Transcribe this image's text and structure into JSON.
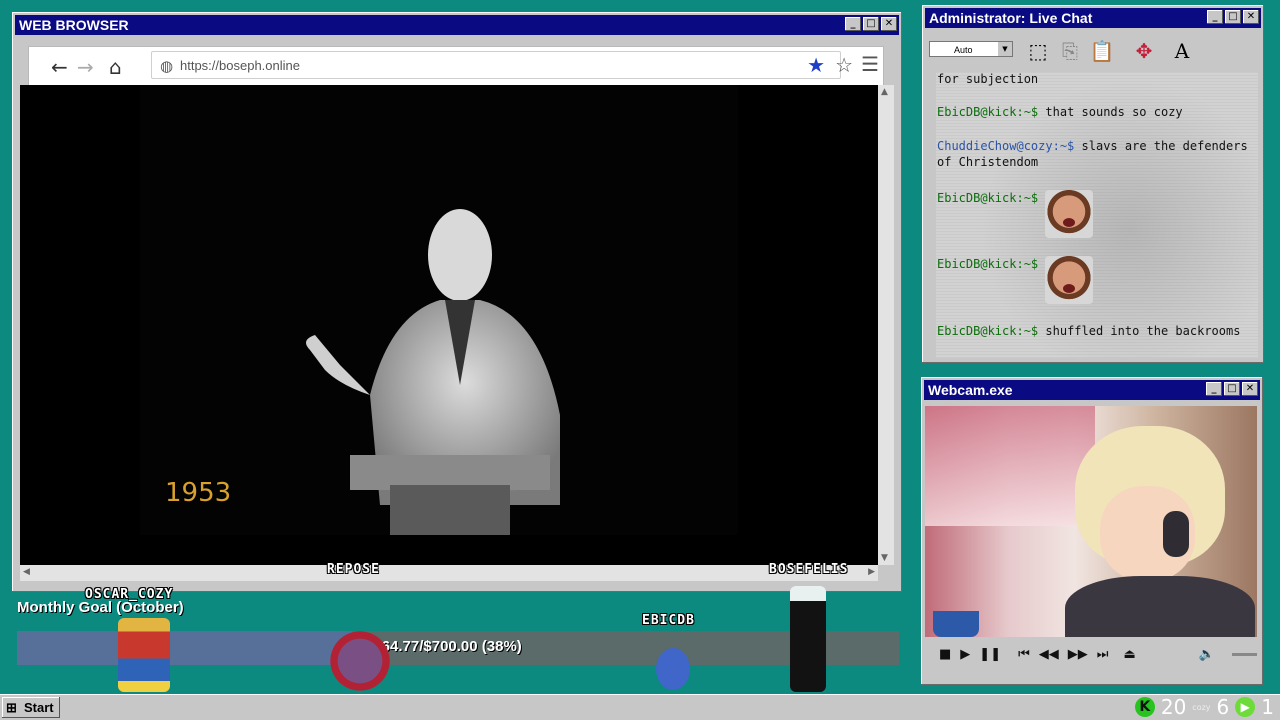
{
  "browser": {
    "title": "WEB BROWSER",
    "url": "https://boseph.online",
    "video_year": "1953",
    "controls": {
      "minimize": "_",
      "maximize": "□",
      "close": "✕"
    },
    "nav_icons": [
      "back-arrow-icon",
      "forward-arrow-icon",
      "home-icon",
      "globe-icon",
      "bookmark-star-icon",
      "star-outline-icon",
      "menu-icon"
    ]
  },
  "name_tags": [
    "REPOSE",
    "BOSEFELIS",
    "OSCAR_COZY",
    "EBICDB"
  ],
  "chat": {
    "title": "Administrator: Live Chat",
    "mode": "Auto",
    "messages": [
      {
        "user": "",
        "text": "for subjection"
      },
      {
        "user": "EbicDB@kick:~$",
        "text": "that sounds so cozy"
      },
      {
        "user": "ChuddieChow@cozy:~$",
        "text": "slavs are the defenders of Christendom"
      },
      {
        "user": "EbicDB@kick:~$",
        "text": "",
        "emote": "shocked-face-emote"
      },
      {
        "user": "EbicDB@kick:~$",
        "text": "",
        "emote": "shocked-face-emote"
      },
      {
        "user": "EbicDB@kick:~$",
        "text": "shuffled into the backrooms"
      }
    ],
    "toolbar_icons": [
      "select-icon",
      "copy-icon",
      "paste-icon",
      "move-icon",
      "font-icon"
    ]
  },
  "webcam": {
    "title": "Webcam.exe",
    "player_icons": [
      "stop-icon",
      "play-icon",
      "pause-icon",
      "prev-icon",
      "rewind-icon",
      "forward-icon",
      "next-icon",
      "eject-icon",
      "volume-icon"
    ]
  },
  "goal": {
    "label": "Monthly Goal (October)",
    "text": "$264.77/$700.00 (38%)",
    "progress": 0.38
  },
  "taskbar": {
    "start_label": "Start",
    "tray_num1": "20",
    "tray_small": "cozy",
    "tray_num2": "6",
    "tray_num3": "1"
  },
  "colors": {
    "desktop": "#0c8a80",
    "titlebar": "#0a0a82",
    "goal_fill": "#56709a"
  }
}
